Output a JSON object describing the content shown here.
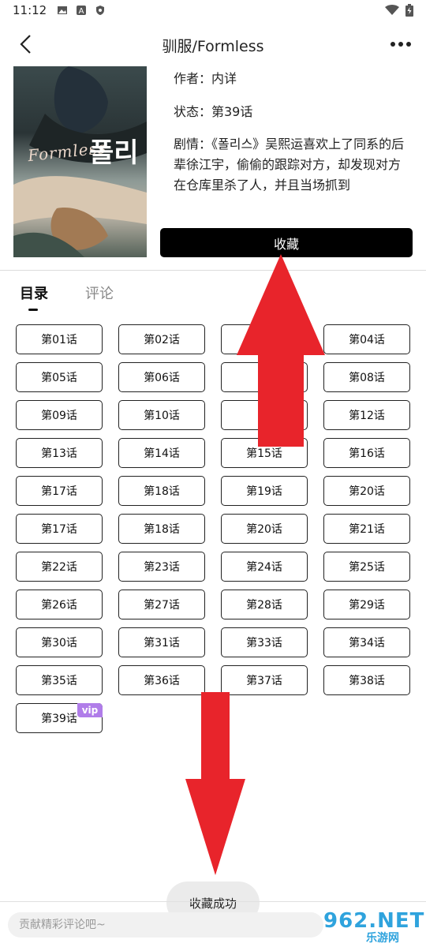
{
  "status_bar": {
    "time": "11:12"
  },
  "header": {
    "title": "驯服/Formless"
  },
  "cover": {
    "logo_text": "Formless",
    "glyph_text": "폴리"
  },
  "info": {
    "author": "作者：内详",
    "status": "状态：第39话",
    "plot": "剧情：《폴리스》吴熙运喜欢上了同系的后辈徐江宇，偷偷的跟踪对方，却发现对方在仓库里杀了人，并且当场抓到"
  },
  "collect_button": "收藏",
  "tabs": {
    "catalog": "目录",
    "comments": "评论"
  },
  "chapters": [
    "第01话",
    "第02话",
    "",
    "第04话",
    "第05话",
    "第06话",
    "第",
    "第08话",
    "第09话",
    "第10话",
    "第",
    "第12话",
    "第13话",
    "第14话",
    "第15话",
    "第16话",
    "第17话",
    "第18话",
    "第19话",
    "第20话",
    "第17话",
    "第18话",
    "第20话",
    "第21话",
    "第22话",
    "第23话",
    "第24话",
    "第25话",
    "第26话",
    "第27话",
    "第28话",
    "第29话",
    "第30话",
    "第31话",
    "第33话",
    "第34话",
    "第35话",
    "第36话",
    "第37话",
    "第38话",
    "第39话"
  ],
  "vip_label": "vip",
  "toast": "收藏成功",
  "comment_input": {
    "placeholder": "贡献精彩评论吧~"
  },
  "watermark": {
    "main": "962.NET",
    "sub": "乐游网"
  },
  "colors": {
    "arrow": "#e8242b",
    "vip": "#b07de9",
    "button": "#000000"
  }
}
